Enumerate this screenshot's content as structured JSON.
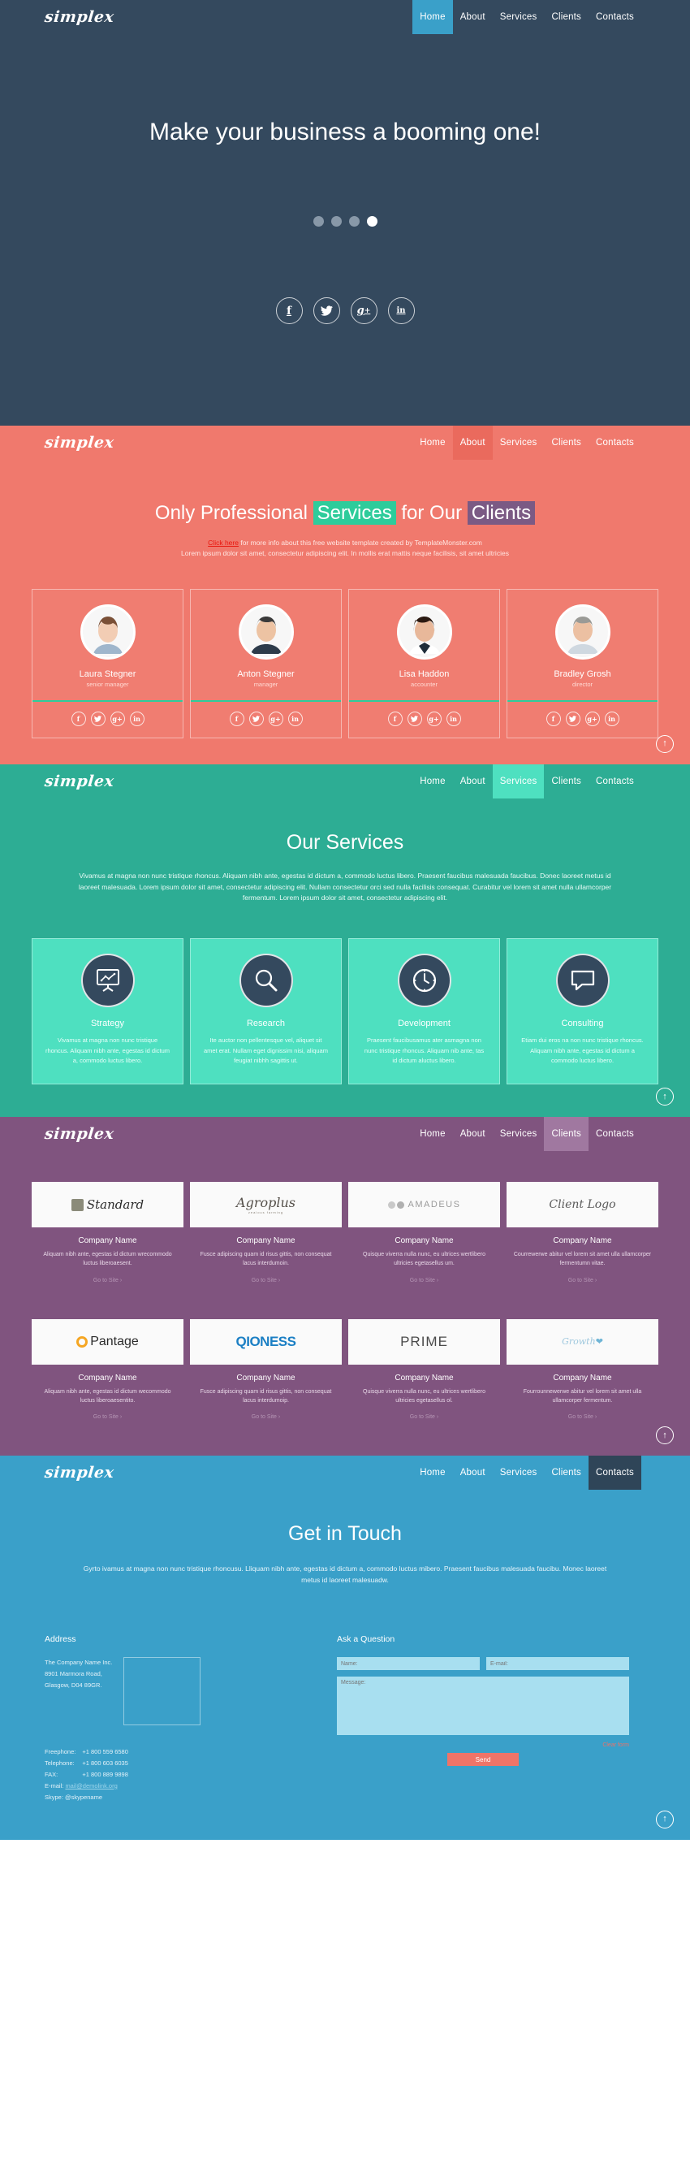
{
  "brand": "simplex",
  "nav": {
    "items": [
      "Home",
      "About",
      "Services",
      "Clients",
      "Contacts"
    ]
  },
  "hero": {
    "title": "Make your business a booming one!",
    "dots": 4,
    "active_dot": 4,
    "socials": [
      "facebook-icon",
      "twitter-icon",
      "googleplus-icon",
      "linkedin-icon"
    ],
    "social_glyphs": [
      "f",
      "ᴗ",
      "g+",
      "in"
    ],
    "bg_color": "#34495e"
  },
  "about": {
    "title_a": "Only Professional ",
    "title_hl1": "Services",
    "title_b": " for Our ",
    "title_hl2": "Clients",
    "link_text": "Click here",
    "sub_line1": " for more info about this free website template created by TemplateMonster.com",
    "sub_line2": "Lorem ipsum dolor sit amet, consectetur adipiscing elit. In mollis erat mattis neque facilisis, sit amet ultricies",
    "bg_color": "#f0796d",
    "team": [
      {
        "name": "Laura Stegner",
        "role": "senior manager"
      },
      {
        "name": "Anton Stegner",
        "role": "manager"
      },
      {
        "name": "Lisa Haddon",
        "role": "accounter"
      },
      {
        "name": "Bradley Grosh",
        "role": "director"
      }
    ]
  },
  "services": {
    "title": "Our Services",
    "body": "Vivamus at magna non nunc tristique rhoncus. Aliquam nibh ante, egestas id dictum a, commodo luctus libero. Praesent faucibus malesuada faucibus. Donec laoreet metus id laoreet malesuada. Lorem ipsum dolor sit amet, consectetur adipiscing elit. Nullam consectetur orci sed nulla facilisis consequat. Curabitur vel lorem sit amet nulla ullamcorper fermentum. Lorem ipsum dolor sit amet, consectetur adipiscing elit.",
    "bg_color": "#2dad94",
    "cards": [
      {
        "icon": "presentation-chart-icon",
        "name": "Strategy",
        "text": "Vivamus at magna non nunc tristique rhoncus. Aliquam nibh ante, egestas id dictum a, commodo luctus libero."
      },
      {
        "icon": "magnifier-icon",
        "name": "Research",
        "text": "Ite auctor non pellentesque vel, aliquet sit amet erat. Nullam eget dignissim nisi, aliquam feugiat nibhh sagittis ut."
      },
      {
        "icon": "clock-icon",
        "name": "Development",
        "text": "Praesent faucibusamus ater asmagna non nunc tristique rhoncus. Aliquam nib ante, tas id dictum aluctus libero."
      },
      {
        "icon": "speech-bubble-icon",
        "name": "Consulting",
        "text": "Etiam dui eros na non nunc tristique rhoncus. Aliquam nibh ante, egestas id dictum a commodo luctus libero."
      }
    ]
  },
  "clients": {
    "bg_color": "#80547f",
    "row1": [
      {
        "logo": "Standard",
        "logo_style": "standard",
        "name": "Company Name",
        "text": "Aliquam nibh ante, egestas id dictum wrecommodo luctus liberoaesent.",
        "link": "Go to Site ›"
      },
      {
        "logo": "Agroplus",
        "logo_style": "agroplus",
        "name": "Company Name",
        "text": "Fusce adipiscing quam id risus gittis, non consequat lacus interdumoin.",
        "link": "Go to Site ›"
      },
      {
        "logo": "AMADEUS",
        "logo_style": "amadeus",
        "name": "Company Name",
        "text": "Quisque viverra nulla nunc, eu ultrices wertlibero ultricies egetasellus um.",
        "link": "Go to Site ›"
      },
      {
        "logo": "Client Logo",
        "logo_style": "clientlogo",
        "name": "Company Name",
        "text": "Courrewerwe abitur vel lorem sit amet ulla ullamcorper fermentumn vitae.",
        "link": "Go to Site ›"
      }
    ],
    "row2": [
      {
        "logo": "Pantage",
        "logo_style": "pantage",
        "name": "Company Name",
        "text": "Aliquam nibh ante, egestas id dictum wecommodo luctus liberoaesentito.",
        "link": "Go to Site ›"
      },
      {
        "logo": "QIONESS",
        "logo_style": "qioness",
        "name": "Company Name",
        "text": "Fusce adipiscing quam id risus gittis, non consequat lacus interdumoip.",
        "link": "Go to Site ›"
      },
      {
        "logo": "PRIME",
        "logo_style": "prime",
        "name": "Company Name",
        "text": "Quisque viverra nulla nunc, eu ultrices wertlibero ultricies egetasellus ol.",
        "link": "Go to Site ›"
      },
      {
        "logo": "Growth",
        "logo_style": "growth",
        "name": "Company Name",
        "text": "Fourrounnewerwe abitur vel lorem sit amet ulla ullamcorper fermentum.",
        "link": "Go to Site ›"
      }
    ]
  },
  "contacts": {
    "title": "Get in Touch",
    "body": "Gyrto ivamus at magna non nunc tristique rhoncusu. Lliquam nibh ante, egestas id dictum a, commodo luctus mibero. Praesent faucibus malesuada faucibu. Monec laoreet metus id laoreet malesuadw.",
    "bg_color": "#3aa0c9",
    "address_heading": "Address",
    "address_lines": [
      "The Company Name Inc.",
      "8901 Marmora Road,",
      "Glasgow, D04 89GR."
    ],
    "phone_rows": [
      {
        "label": "Freephone:",
        "value": "+1 800 559 6580"
      },
      {
        "label": "Telephone:",
        "value": "+1 800 603 6035"
      },
      {
        "label": "FAX:",
        "value": "+1 800 889 9898"
      }
    ],
    "email_label": "E-mail:",
    "email_value": "mail@demolink.org",
    "skype_label": "Skype:",
    "skype_value": "@skypename",
    "form_heading": "Ask a Question",
    "name_placeholder": "Name:",
    "email_placeholder": "E-mail:",
    "message_placeholder": "Message:",
    "clear_label": "Clear form",
    "send_label": "Send"
  },
  "to_top": "↑"
}
